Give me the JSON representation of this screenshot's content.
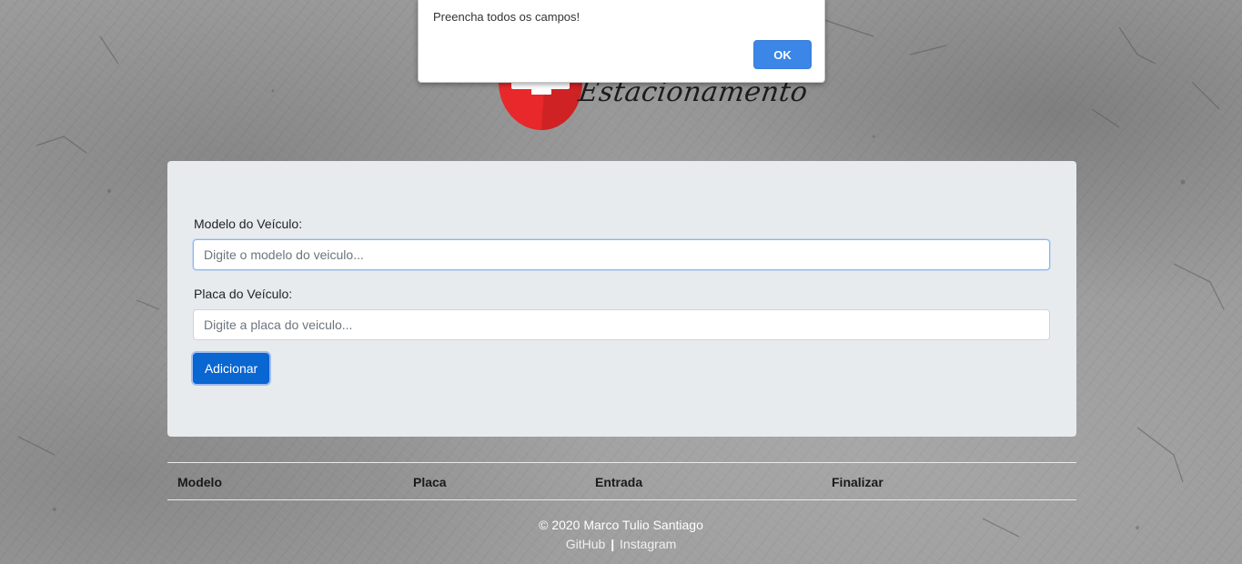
{
  "alert": {
    "message": "Preencha todos os campos!",
    "ok_label": "OK"
  },
  "logo": {
    "text": "Estacionamento"
  },
  "form": {
    "model_label": "Modelo do Veículo:",
    "model_placeholder": "Digite o modelo do veiculo...",
    "model_value": "",
    "plate_label": "Placa do Veículo:",
    "plate_placeholder": "Digite a placa do veiculo...",
    "plate_value": "",
    "add_button": "Adicionar"
  },
  "table": {
    "columns": [
      "Modelo",
      "Placa",
      "Entrada",
      "Finalizar"
    ],
    "rows": []
  },
  "footer": {
    "copyright": "© 2020 Marco Tulio Santiago",
    "github": "GitHub",
    "separator": "|",
    "instagram": "Instagram"
  },
  "colors": {
    "primary": "#0a66d0",
    "alert_ok": "#3b86e6",
    "logo_red": "#e8282b"
  }
}
